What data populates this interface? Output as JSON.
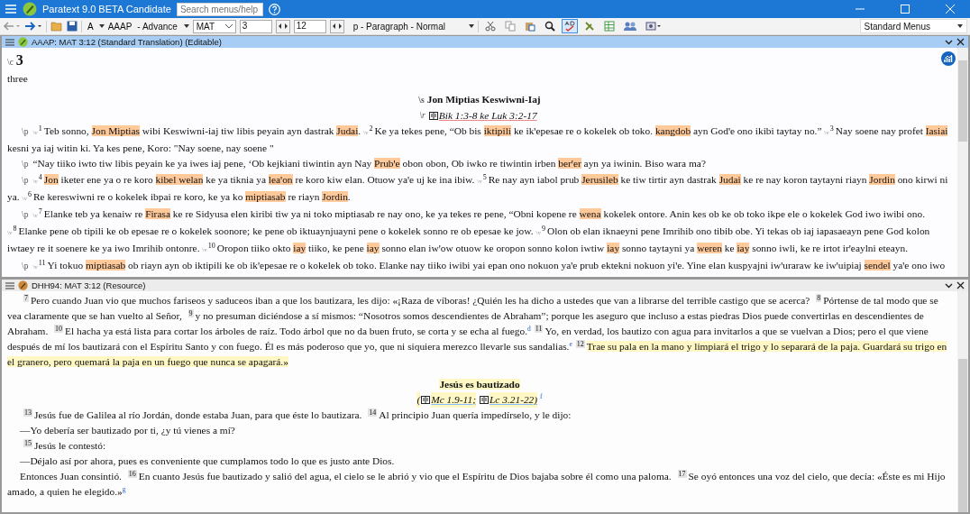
{
  "window": {
    "title": "Paratext 9.0 BETA Candidate"
  },
  "search": {
    "placeholder": "Search menus/help"
  },
  "toolbar": {
    "font": "A",
    "project": "AAAP",
    "project_name": "- Advance",
    "book": "MAT",
    "chapter": "3",
    "verse": "12",
    "style": "p - Paragraph - Normal",
    "menus": "Standard Menus",
    "tools": [
      {
        "kind": "cut",
        "selected": false
      },
      {
        "kind": "copy",
        "selected": false
      },
      {
        "kind": "paste",
        "selected": false
      },
      {
        "kind": "find",
        "selected": false
      },
      {
        "kind": "spell",
        "selected": true
      },
      {
        "kind": "wrench",
        "selected": false
      },
      {
        "kind": "grid",
        "selected": false
      },
      {
        "kind": "people",
        "selected": false
      },
      {
        "kind": "link",
        "selected": false
      }
    ]
  },
  "panes": [
    {
      "kind": "editable",
      "title": "AAAP: MAT 3:12 (Standard Translation) (Editable)",
      "blocks": [
        {
          "kind": "chapter",
          "marker": "\\c",
          "text": "3"
        },
        {
          "kind": "plain",
          "text": "three"
        },
        {
          "kind": "heading",
          "marker": "\\s",
          "text": "Jon Miptias Keswiwni-Iaj",
          "highlighted": false
        },
        {
          "kind": "reference",
          "marker": "\\r",
          "segments": [
            {
              "kind": "book",
              "text": "Bik 1:3-8 ke Luk 3:2-17",
              "highlighted": false
            }
          ]
        },
        {
          "kind": "paragraph",
          "marker": "\\p",
          "segments": [
            {
              "kind": "marker",
              "text": "\\v"
            },
            {
              "kind": "verse",
              "text": "1"
            },
            {
              "kind": "text",
              "text": "Teb sonno, ",
              "highlighted": false
            },
            {
              "kind": "text",
              "text": "Jon Miptias",
              "highlighted": true
            },
            {
              "kind": "text",
              "text": " wibi Keswiwni-iaj tiw libis peyain ayn dastrak ",
              "highlighted": false
            },
            {
              "kind": "text",
              "text": "Judai",
              "highlighted": true
            },
            {
              "kind": "text",
              "text": ". ",
              "highlighted": false
            },
            {
              "kind": "marker",
              "text": "\\v"
            },
            {
              "kind": "verse",
              "text": "2"
            },
            {
              "kind": "text",
              "text": "Ke ya tekes pene, “Ob bis ",
              "highlighted": false
            },
            {
              "kind": "text",
              "text": "iktipili",
              "highlighted": true
            },
            {
              "kind": "text",
              "text": " ke ikꞌepesae re o kokelek ob toko. ",
              "highlighted": false
            },
            {
              "kind": "text",
              "text": "kangdob",
              "highlighted": true
            },
            {
              "kind": "text",
              "text": " ayn Godꞌe ono ikibi taytay no.” ",
              "highlighted": false
            },
            {
              "kind": "marker",
              "text": "\\v"
            },
            {
              "kind": "verse",
              "text": "3"
            },
            {
              "kind": "text",
              "text": "Nay soene nay profet ",
              "highlighted": false
            },
            {
              "kind": "text",
              "text": "Iasiai",
              "highlighted": true
            },
            {
              "kind": "text",
              "text": " kesni ya iaj witin ki. Ya kes pene, Koro: \"Nay soene, nay soene \"",
              "highlighted": false
            }
          ]
        },
        {
          "kind": "paragraph",
          "marker": "\\p",
          "segments": [
            {
              "kind": "text",
              "text": "“Nay tiiko iwto tiw libis peyain ke ya iwes iaj pene, ‘Ob kejkiani tiwintin ayn Nay ",
              "highlighted": false
            },
            {
              "kind": "text",
              "text": "Prubꞌe",
              "highlighted": true
            },
            {
              "kind": "text",
              "text": " obon obon, Ob iwko re tiwintin irben ",
              "highlighted": false
            },
            {
              "kind": "text",
              "text": "berꞌer",
              "highlighted": true
            },
            {
              "kind": "text",
              "text": " ayn ya iwinin. Biso wara ma?",
              "highlighted": false
            }
          ]
        },
        {
          "kind": "paragraph",
          "marker": "\\p",
          "segments": [
            {
              "kind": "marker",
              "text": "\\v"
            },
            {
              "kind": "verse",
              "text": "4"
            },
            {
              "kind": "text",
              "text": "Jon",
              "highlighted": true
            },
            {
              "kind": "text",
              "text": " iketer ene ya o re koro ",
              "highlighted": false
            },
            {
              "kind": "text",
              "text": "kibel welan",
              "highlighted": true
            },
            {
              "kind": "text",
              "text": " ke ya tiknia ya ",
              "highlighted": false
            },
            {
              "kind": "text",
              "text": "leaꞌon",
              "highlighted": true
            },
            {
              "kind": "text",
              "text": " re koro kiw elan. Otuow yaꞌe uj ke ina ibiw. ",
              "highlighted": false
            },
            {
              "kind": "marker",
              "text": "\\v"
            },
            {
              "kind": "verse",
              "text": "5"
            },
            {
              "kind": "text",
              "text": "Re nay ayn iabol prub ",
              "highlighted": false
            },
            {
              "kind": "text",
              "text": "Jerusileb",
              "highlighted": true
            },
            {
              "kind": "text",
              "text": " ke tiw tirtir ayn dastrak ",
              "highlighted": false
            },
            {
              "kind": "text",
              "text": "Judai",
              "highlighted": true
            },
            {
              "kind": "text",
              "text": " ke re nay koron taytayni riayn ",
              "highlighted": false
            },
            {
              "kind": "text",
              "text": "Jordin",
              "highlighted": true
            },
            {
              "kind": "text",
              "text": " ono kirwi ni ya. ",
              "highlighted": false
            },
            {
              "kind": "marker",
              "text": "\\v"
            },
            {
              "kind": "verse",
              "text": "6"
            },
            {
              "kind": "text",
              "text": "Re kereswiwni re o kokelek ibpai re koro, ke ya ko ",
              "highlighted": false
            },
            {
              "kind": "text",
              "text": "miptiasab",
              "highlighted": true
            },
            {
              "kind": "text",
              "text": " re riayn ",
              "highlighted": false
            },
            {
              "kind": "text",
              "text": "Jordin",
              "highlighted": true
            },
            {
              "kind": "text",
              "text": ".",
              "highlighted": false
            }
          ]
        },
        {
          "kind": "paragraph",
          "marker": "\\p",
          "segments": [
            {
              "kind": "marker",
              "text": "\\v"
            },
            {
              "kind": "verse",
              "text": "7"
            },
            {
              "kind": "text",
              "text": "Elanke teb ya kenaiw re ",
              "highlighted": false
            },
            {
              "kind": "text",
              "text": "Firasa",
              "highlighted": true
            },
            {
              "kind": "text",
              "text": " ke re Sidyusa elen kiribi tiw ya ni toko miptiasab re nay ono, ke ya tekes re pene, “Obni kopene re ",
              "highlighted": false
            },
            {
              "kind": "text",
              "text": "wena",
              "highlighted": true
            },
            {
              "kind": "text",
              "text": " kokelek ontore. Anin kes ob ke ob toko ikpe ele o kokelek God iwo iwibi ono. ",
              "highlighted": false
            },
            {
              "kind": "marker",
              "text": "\\v"
            },
            {
              "kind": "verse",
              "text": "8"
            },
            {
              "kind": "text",
              "text": "Elanke pene ob tipili ke ob epesae re o kokelek soonore; ke pene ob iktuaynjuayni pene o kokelek sonno re ob epesae ke jow. ",
              "highlighted": false
            },
            {
              "kind": "marker",
              "text": "\\v"
            },
            {
              "kind": "verse",
              "text": "9"
            },
            {
              "kind": "text",
              "text": "Olon ob elan iknaeyni pene Imrihib ono tibib obe. Yi tekas ob iaj iapasaeayn pene God kolon iwtaey re it soenere ke ya iwo Imrihib ontonre. ",
              "highlighted": false
            },
            {
              "kind": "marker",
              "text": "\\v"
            },
            {
              "kind": "verse",
              "text": "10"
            },
            {
              "kind": "text",
              "text": "Oropon tiiko okto ",
              "highlighted": false
            },
            {
              "kind": "text",
              "text": "iay",
              "highlighted": true
            },
            {
              "kind": "text",
              "text": " tiiko, ke pene ",
              "highlighted": false
            },
            {
              "kind": "text",
              "text": "iay",
              "highlighted": true
            },
            {
              "kind": "text",
              "text": " sonno elan iwꞌow otuow ke oropon sonno kolon iwtiw ",
              "highlighted": false
            },
            {
              "kind": "text",
              "text": "iay",
              "highlighted": true
            },
            {
              "kind": "text",
              "text": " sonno taytayni ya ",
              "highlighted": false
            },
            {
              "kind": "text",
              "text": "weren",
              "highlighted": true
            },
            {
              "kind": "text",
              "text": " ke ",
              "highlighted": false
            },
            {
              "kind": "text",
              "text": "iay",
              "highlighted": true
            },
            {
              "kind": "text",
              "text": " sonno iwli, ke re irtot irꞌeaylni eteayn.",
              "highlighted": false
            }
          ]
        },
        {
          "kind": "paragraph",
          "marker": "\\p",
          "segments": [
            {
              "kind": "marker",
              "text": "\\v"
            },
            {
              "kind": "verse",
              "text": "11"
            },
            {
              "kind": "text",
              "text": "Yi tokuo ",
              "highlighted": false
            },
            {
              "kind": "text",
              "text": "miptiasab",
              "highlighted": true
            },
            {
              "kind": "text",
              "text": " ob riayn ayn ob iktipili ke ob ikꞌepesae re o kokelek ob toko. Elanke nay tiiko iwibi yai epan ono nokuon yaꞌe prub ektekni nokuon yiꞌe. Yine elan kuspyajni iwꞌuraraw ke iwꞌuipiaj ",
              "highlighted": false
            },
            {
              "kind": "text",
              "text": "sendel",
              "highlighted": true
            },
            {
              "kind": "text",
              "text": " yaꞌe ono iwo",
              "highlighted": false
            }
          ]
        }
      ]
    },
    {
      "kind": "resource",
      "title": "DHH94: MAT 3:12 (Resource)",
      "blocks": [
        {
          "kind": "paragraph",
          "segments": [
            {
              "kind": "verse",
              "text": "7"
            },
            {
              "kind": "text",
              "text": "Pero cuando Juan vio que muchos fariseos y saduceos iban a que los bautizara, les dijo: «¡Raza de víboras! ¿Quién les ha dicho a ustedes que van a librarse del terrible castigo que se acerca? ",
              "highlighted": false
            },
            {
              "kind": "verse",
              "text": "8"
            },
            {
              "kind": "text",
              "text": "Pórtense de tal modo que se vea claramente que se han vuelto al Señor, ",
              "highlighted": false
            },
            {
              "kind": "verse",
              "text": "9"
            },
            {
              "kind": "text",
              "text": "y no presuman diciéndose a sí mismos: “Nosotros somos descendientes de Abraham”; porque les aseguro que incluso a estas piedras Dios puede convertirlas en descendientes de Abraham. ",
              "highlighted": false
            },
            {
              "kind": "verse",
              "text": "10"
            },
            {
              "kind": "text",
              "text": "El hacha ya está lista para cortar los árboles de raíz. Todo árbol que no da buen fruto, se corta y se echa al fuego.",
              "highlighted": false
            },
            {
              "kind": "note",
              "text": "d"
            },
            {
              "kind": "verse",
              "text": "11"
            },
            {
              "kind": "text",
              "text": "Yo, en verdad, los bautizo con agua para invitarlos a que se vuelvan a Dios; pero el que viene después de mí los bautizará con el Espíritu Santo y con fuego. Él es más poderoso que yo, que ni siquiera merezco llevarle sus sandalias.",
              "highlighted": false
            },
            {
              "kind": "note",
              "text": "e"
            },
            {
              "kind": "verse",
              "text": "12"
            },
            {
              "kind": "text",
              "text": "Trae su pala en la mano y limpiará el trigo y lo separará de la paja. Guardará su trigo en el granero, pero quemará la paja en un fuego que nunca se apagará.»",
              "highlighted": true
            }
          ]
        },
        {
          "kind": "heading",
          "text": "Jesús es bautizado",
          "highlighted": true
        },
        {
          "kind": "reference",
          "segments": [
            {
              "kind": "text",
              "text": "(",
              "highlighted": true
            },
            {
              "kind": "book",
              "text": "Mc 1.9-11;",
              "highlighted": true
            },
            {
              "kind": "book",
              "text": "Lc 3.21-22)",
              "highlighted": true
            },
            {
              "kind": "note",
              "text": "f"
            }
          ]
        },
        {
          "kind": "paragraph",
          "segments": [
            {
              "kind": "verse",
              "text": "13"
            },
            {
              "kind": "text",
              "text": "Jesús fue de Galilea al río Jordán, donde estaba Juan, para que éste lo bautizara. ",
              "highlighted": false
            },
            {
              "kind": "verse",
              "text": "14"
            },
            {
              "kind": "text",
              "text": "Al principio Juan quería impedírselo, y le dijo:",
              "highlighted": false
            }
          ]
        },
        {
          "kind": "paragraph",
          "segments": [
            {
              "kind": "text",
              "text": "—Yo debería ser bautizado por ti, ¿y tú vienes a mí?",
              "highlighted": false
            }
          ]
        },
        {
          "kind": "paragraph",
          "segments": [
            {
              "kind": "verse",
              "text": "15"
            },
            {
              "kind": "text",
              "text": "Jesús le contestó:",
              "highlighted": false
            }
          ]
        },
        {
          "kind": "paragraph",
          "segments": [
            {
              "kind": "text",
              "text": "—Déjalo así por ahora, pues es conveniente que cumplamos todo lo que es justo ante Dios.",
              "highlighted": false
            }
          ]
        },
        {
          "kind": "paragraph",
          "segments": [
            {
              "kind": "text",
              "text": "Entonces Juan consintió. ",
              "highlighted": false
            },
            {
              "kind": "verse",
              "text": "16"
            },
            {
              "kind": "text",
              "text": "En cuanto Jesús fue bautizado y salió del agua, el cielo se le abrió y vio que el Espíritu de Dios bajaba sobre él como una paloma. ",
              "highlighted": false
            },
            {
              "kind": "verse",
              "text": "17"
            },
            {
              "kind": "text",
              "text": "Se oyó entonces una voz del cielo, que decía: «Éste es mi Hijo amado, a quien he elegido.»",
              "highlighted": false
            },
            {
              "kind": "note",
              "text": "g"
            }
          ]
        }
      ]
    }
  ]
}
